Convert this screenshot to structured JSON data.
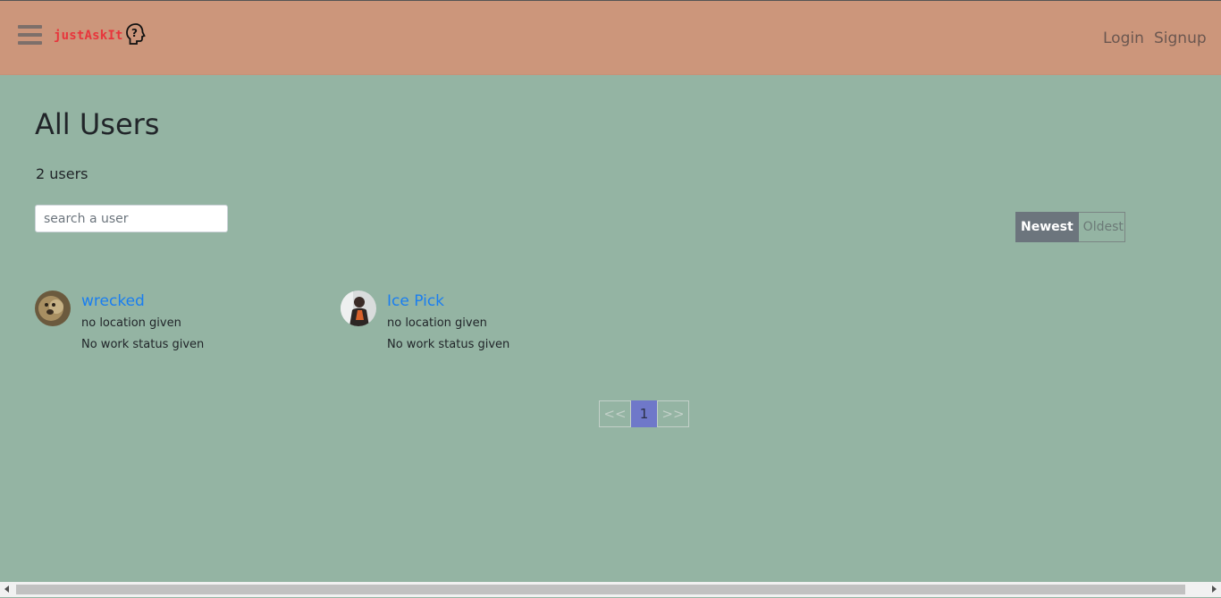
{
  "header": {
    "brand": "justAskIt",
    "brand_icon": "question-head-icon",
    "login_label": "Login",
    "signup_label": "Signup"
  },
  "main": {
    "title": "All Users",
    "count_text": "2 users",
    "search": {
      "placeholder": "search a user"
    },
    "sort": {
      "newest_label": "Newest",
      "oldest_label": "Oldest",
      "active": "Newest"
    },
    "users": [
      {
        "name": "wrecked",
        "location": "no location given",
        "work": "No work status given"
      },
      {
        "name": "Ice Pick",
        "location": "no location given",
        "work": "No work status given"
      }
    ],
    "pagination": {
      "prev": "<<",
      "current": "1",
      "next": ">>"
    }
  },
  "colors": {
    "header_bg": "#cc967b",
    "page_bg": "#94b4a3",
    "brand": "#e8353c",
    "link": "#1a7ef0",
    "active_page": "#6f78c9"
  }
}
